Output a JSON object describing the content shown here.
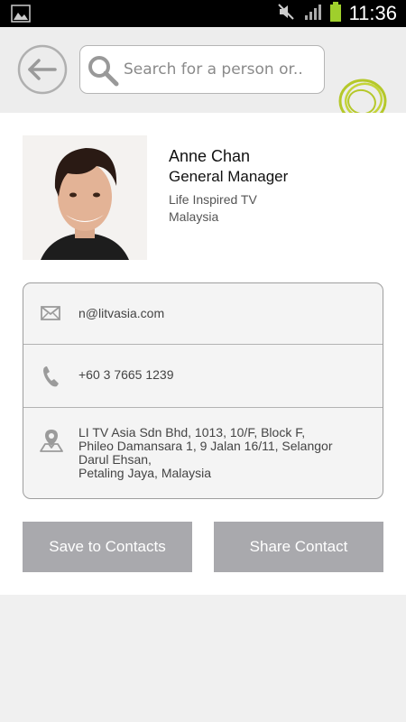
{
  "status_bar": {
    "time": "11:36",
    "left_icon": "image-icon",
    "icons": [
      "mute-icon",
      "signal-icon",
      "battery-icon"
    ]
  },
  "header": {
    "back_icon": "back-arrow-icon",
    "search": {
      "placeholder": "Search for a person or..",
      "value": ""
    },
    "logo": "logo-icon"
  },
  "profile": {
    "name": "Anne Chan",
    "title": "General Manager",
    "company": "Life Inspired TV",
    "country": "Malaysia"
  },
  "contact": {
    "email": "n@litvasia.com",
    "phone": "+60 3 7665 1239",
    "address_lines": [
      "LI TV Asia Sdn Bhd, 1013, 10/F, Block F,",
      "Phileo Damansara 1, 9 Jalan 16/11, Selangor",
      "Darul Ehsan,",
      "Petaling Jaya, Malaysia"
    ]
  },
  "actions": {
    "save_label": "Save to Contacts",
    "share_label": "Share Contact"
  },
  "colors": {
    "accent": "#b5c82a",
    "button": "#a9a9ad",
    "header_bg": "#ededed"
  }
}
